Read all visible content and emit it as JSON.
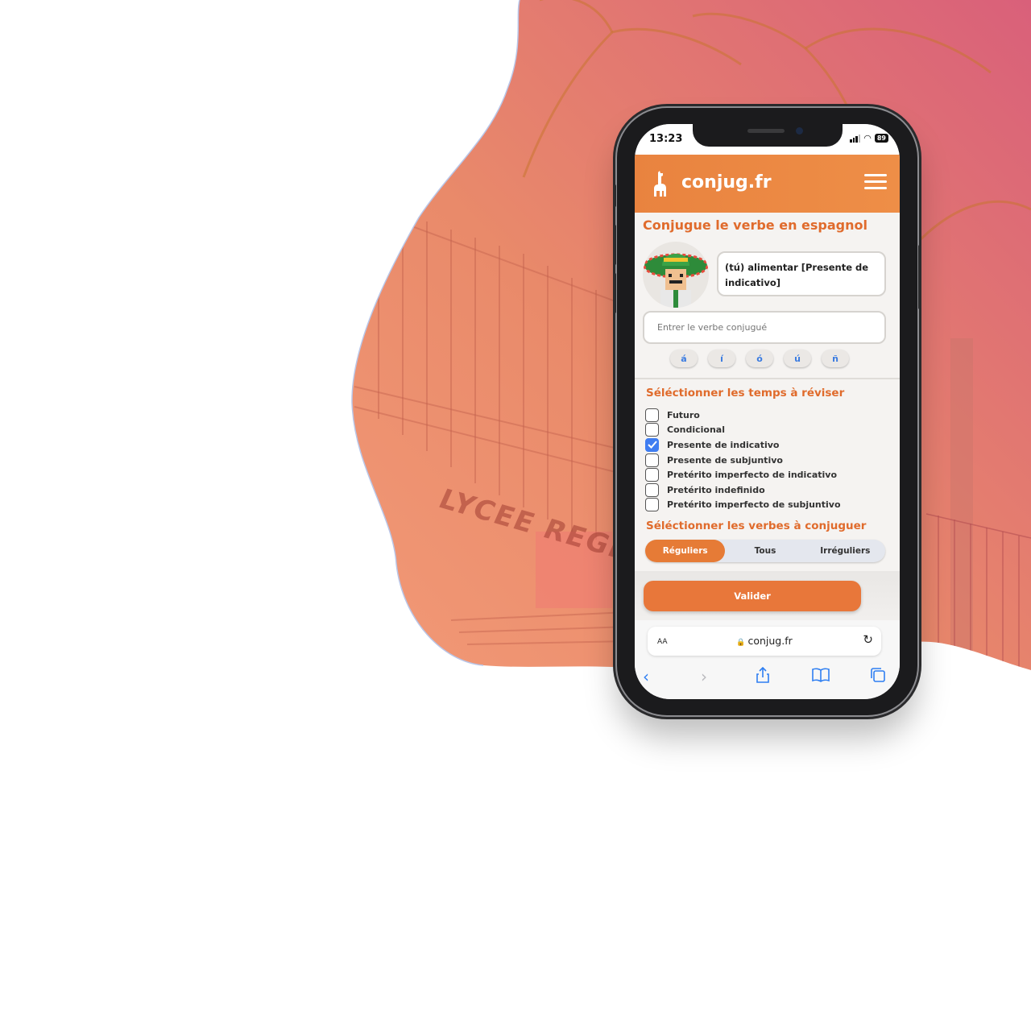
{
  "status_bar": {
    "time": "13:23",
    "battery": "89"
  },
  "app": {
    "brand": "conjug.fr"
  },
  "exercise": {
    "title": "Conjugue le verbe en espagnol",
    "prompt": "(tú) alimentar [Presente de indicativo]",
    "input_placeholder": "Entrer le verbe conjugué",
    "accent_keys": [
      "á",
      "í",
      "ó",
      "ú",
      "ñ"
    ]
  },
  "tenses_section": {
    "title": "Séléctionner les temps à réviser",
    "items": [
      {
        "label": "Futuro",
        "checked": false
      },
      {
        "label": "Condicional",
        "checked": false
      },
      {
        "label": "Presente de indicativo",
        "checked": true
      },
      {
        "label": "Presente de subjuntivo",
        "checked": false
      },
      {
        "label": "Pretérito imperfecto de indicativo",
        "checked": false
      },
      {
        "label": "Pretérito indefinido",
        "checked": false
      },
      {
        "label": "Pretérito imperfecto de subjuntivo",
        "checked": false
      }
    ]
  },
  "verbs_section": {
    "title": "Séléctionner les verbes à conjuguer",
    "options": [
      "Réguliers",
      "Tous",
      "Irréguliers"
    ],
    "selected": "Réguliers"
  },
  "validate_label": "Valider",
  "browser": {
    "text_size": "AA",
    "url": "conjug.fr"
  },
  "background": {
    "sign_text": "LYCEE REGIONAL"
  },
  "colors": {
    "accent": "#e8773a",
    "title": "#e06b2c",
    "checkbox": "#3f7df1",
    "ios_blue": "#2f7ff2"
  }
}
